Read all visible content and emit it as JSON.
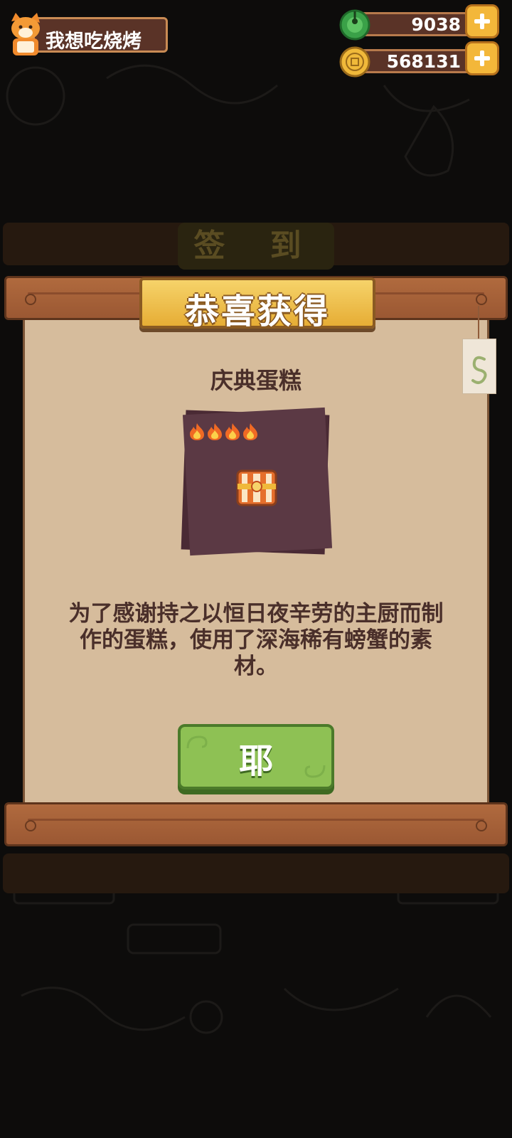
{
  "player": {
    "name": "我想吃烧烤",
    "avatar_icon": "fox-chef-avatar-icon"
  },
  "currencies": [
    {
      "name": "jade",
      "icon": "jade-coin-icon",
      "value": "9038"
    },
    {
      "name": "gold",
      "icon": "gold-coin-icon",
      "value": "568131"
    }
  ],
  "background_panel": {
    "tab_label": "签 到"
  },
  "dialog": {
    "title": "恭喜获得",
    "item_name": "庆典蛋糕",
    "rarity_flames": 4,
    "item_icon": "cake-icon",
    "description": "为了感谢持之以恒日夜辛劳的主厨而制作的蛋糕，使用了深海稀有螃蟹的素材。",
    "confirm_label": "耶",
    "side_tag_icon": "s-hook-tag-icon"
  },
  "colors": {
    "paper": "#d6bc9c",
    "wood": "#a6613a",
    "banner": "#f0c24f",
    "button": "#8ec154",
    "card": "#5b3944",
    "text": "#4a2f2a"
  }
}
